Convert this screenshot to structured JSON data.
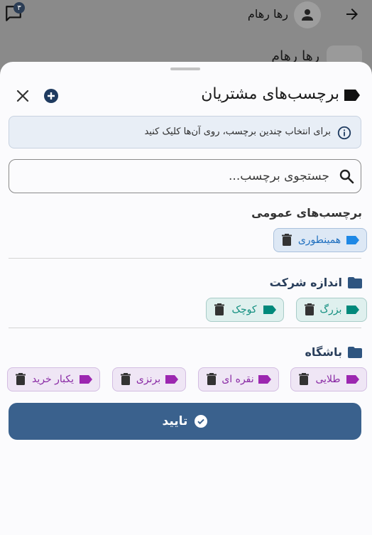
{
  "background": {
    "user_name": "رها رهام",
    "notification_count": "۳",
    "row_name": "رها رهام"
  },
  "sheet": {
    "title": "برچسب‌های مشتریان",
    "info_text": "برای انتخاب چندین برچسب، روی آن‌ها کلیک کنید",
    "search_placeholder": "جستجوی برچسب...",
    "search_value": "",
    "sections": {
      "general": {
        "title": "برچسب‌های عمومی",
        "tags": [
          {
            "label": "همینطوری",
            "color": "#1e88e5"
          }
        ]
      },
      "company_size": {
        "title": "اندازه شرکت",
        "tags": [
          {
            "label": "بزرگ",
            "color": "#00897b"
          },
          {
            "label": "کوچک",
            "color": "#00897b"
          }
        ]
      },
      "club": {
        "title": "باشگاه",
        "tags": [
          {
            "label": "طلایی",
            "color": "#9c27b0"
          },
          {
            "label": "نقره ای",
            "color": "#9c27b0"
          },
          {
            "label": "برنزی",
            "color": "#9c27b0"
          },
          {
            "label": "یکبار خرید",
            "color": "#9c27b0"
          }
        ]
      }
    },
    "confirm_label": "تایید"
  },
  "colors": {
    "primary": "#3a618d",
    "info_bg": "#e8eef6",
    "folder": "#2f5580"
  }
}
